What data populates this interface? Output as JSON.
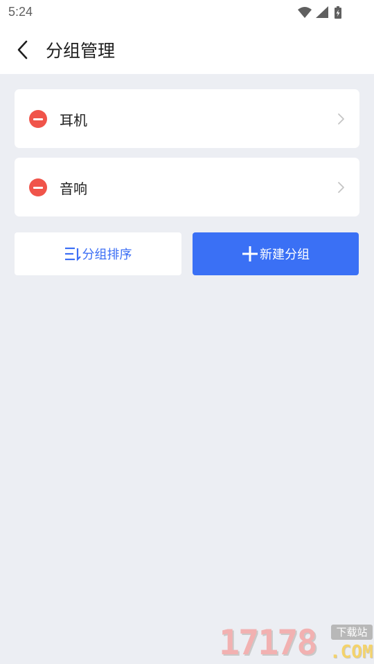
{
  "status_bar": {
    "time": "5:24"
  },
  "header": {
    "title": "分组管理"
  },
  "groups": [
    {
      "name": "耳机"
    },
    {
      "name": "音响"
    }
  ],
  "actions": {
    "sort_label": "分组排序",
    "new_label": "新建分组"
  },
  "watermark": {
    "number": "17178",
    "tag": "下载站",
    "domain": ".COM"
  },
  "colors": {
    "accent": "#3a70f5",
    "remove": "#f0544a",
    "background": "#eceef3"
  }
}
